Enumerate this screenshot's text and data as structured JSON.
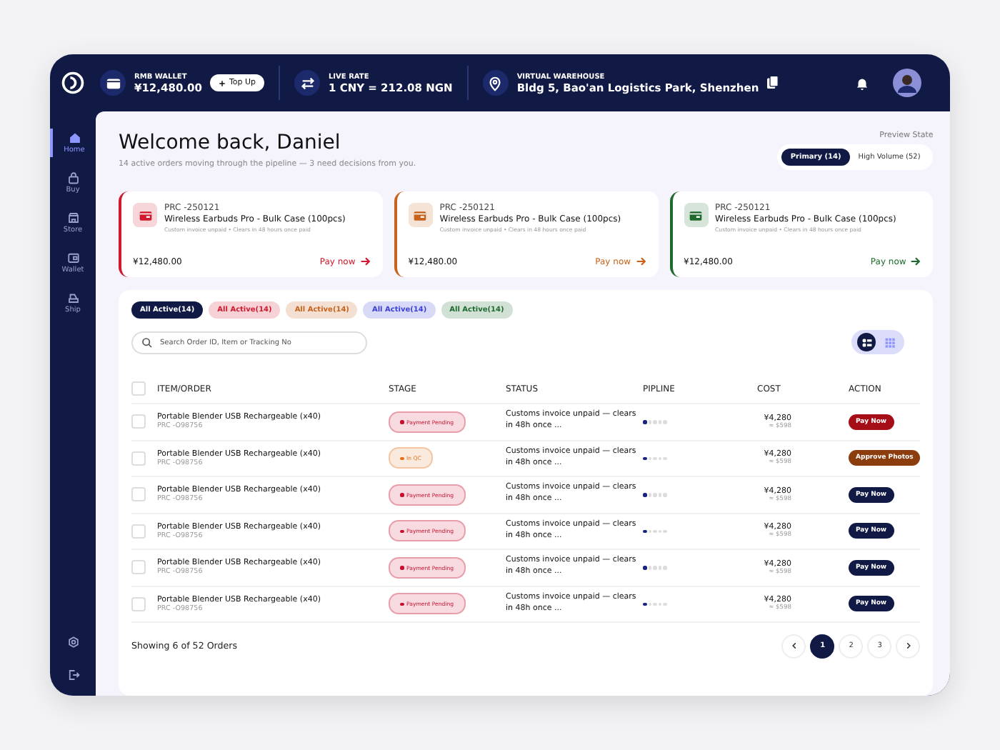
{
  "topbar": {
    "wallet_label": "RMB WALLET",
    "wallet_value": "¥12,480.00",
    "top_up": "Top Up",
    "rate_label": "LIVE RATE",
    "rate_value": "1 CNY = 212.08 NGN",
    "warehouse_label": "VIRTUAL WAREHOUSE",
    "warehouse_value": "Bldg 5, Bao'an Logistics Park, Shenzhen"
  },
  "sidebar": {
    "items": [
      {
        "label": "Home",
        "selected": true
      },
      {
        "label": "Buy",
        "selected": false
      },
      {
        "label": "Store",
        "selected": false
      },
      {
        "label": "Wallet",
        "selected": false
      },
      {
        "label": "Ship",
        "selected": false
      }
    ]
  },
  "header": {
    "title": "Welcome back, Daniel",
    "subtitle": "14 active orders moving through the pipeline — 3 need decisions from you.",
    "preview_label": "Preview State",
    "preview_options": [
      {
        "label": "Primary (14)",
        "selected": true
      },
      {
        "label": "High Volume (52)",
        "selected": false
      }
    ]
  },
  "cards": [
    {
      "code": "PRC -250121",
      "title": "Wireless Earbuds Pro -  Bulk Case (100pcs)",
      "note": "Custom invoice unpaid • Clears in 48 hours once paid",
      "amount": "¥12,480.00",
      "action": "Pay now",
      "color": "#d0192e"
    },
    {
      "code": "PRC -250121",
      "title": "Wireless Earbuds Pro -  Bulk Case (100pcs)",
      "note": "Custom invoice unpaid • Clears in 48 hours once paid",
      "amount": "¥12,480.00",
      "action": "Pay now",
      "color": "#c8621c"
    },
    {
      "code": "PRC -250121",
      "title": "Wireless Earbuds Pro -  Bulk Case (100pcs)",
      "note": "Custom invoice unpaid • Clears in 48 hours once paid",
      "amount": "¥12,480.00",
      "action": "Pay now",
      "color": "#1f6b2e"
    }
  ],
  "filters": [
    {
      "label": "All Active(14)",
      "selected": true,
      "color": "#111a45"
    },
    {
      "label": "All Active(14)",
      "selected": false,
      "color": "#d0192e"
    },
    {
      "label": "All Active(14)",
      "selected": false,
      "color": "#c8621c"
    },
    {
      "label": "All Active(14)",
      "selected": false,
      "color": "#3b3fd6"
    },
    {
      "label": "All Active(14)",
      "selected": false,
      "color": "#1f6b2e"
    }
  ],
  "search": {
    "placeholder": "Search Order ID, Item or Tracking No"
  },
  "view_toggle": [
    {
      "selected": true
    },
    {
      "selected": false
    }
  ],
  "table": {
    "select_all_checked": false,
    "columns": [
      "ITEM/ORDER",
      "STAGE",
      "STATUS",
      "PIPLINE",
      "COST",
      "ACTION"
    ],
    "rows": [
      {
        "checked": false,
        "item": "Portable Blender USB Rechargeable (x40)",
        "order": "PRC -O98756",
        "stage": {
          "label": "Payment Pending",
          "color": "#c8102e"
        },
        "status": "Customs invoice unpaid — clears in 48h once ...",
        "level": 0.2,
        "cost": "¥4,280",
        "cost_usd": "≈ $598",
        "action": {
          "label": "Pay Now",
          "color": "#a50e16"
        }
      },
      {
        "checked": false,
        "item": "Portable Blender USB Rechargeable (x40)",
        "order": "PRC -O98756",
        "stage": {
          "label": "In QC",
          "color": "#e0701e"
        },
        "status": "Customs invoice unpaid — clears in 48h once ...",
        "level": 0.2,
        "cost": "¥4,280",
        "cost_usd": "≈ $598",
        "action": {
          "label": "Approve Photos",
          "color": "#8b3d0d"
        }
      },
      {
        "checked": false,
        "item": "Portable Blender USB Rechargeable (x40)",
        "order": "PRC -O98756",
        "stage": {
          "label": "Payment Pending",
          "color": "#c8102e"
        },
        "status": "Customs invoice unpaid — clears in 48h once ...",
        "level": 0.2,
        "cost": "¥4,280",
        "cost_usd": "≈ $598",
        "action": {
          "label": "Pay Now",
          "color": "#111a45"
        }
      },
      {
        "checked": false,
        "item": "Portable Blender USB Rechargeable (x40)",
        "order": "PRC -O98756",
        "stage": {
          "label": "Payment Pending",
          "color": "#c8102e"
        },
        "status": "Customs invoice unpaid — clears in 48h once ...",
        "level": 0.2,
        "cost": "¥4,280",
        "cost_usd": "≈ $598",
        "action": {
          "label": "Pay Now",
          "color": "#111a45"
        }
      },
      {
        "checked": false,
        "item": "Portable Blender USB Rechargeable (x40)",
        "order": "PRC -O98756",
        "stage": {
          "label": "Payment Pending",
          "color": "#c8102e"
        },
        "status": "Customs invoice unpaid — clears in 48h once ...",
        "level": 0.2,
        "cost": "¥4,280",
        "cost_usd": "≈ $598",
        "action": {
          "label": "Pay Now",
          "color": "#111a45"
        }
      },
      {
        "checked": false,
        "item": "Portable Blender USB Rechargeable (x40)",
        "order": "PRC -O98756",
        "stage": {
          "label": "Payment Pending",
          "color": "#c8102e"
        },
        "status": "Customs invoice unpaid — clears in 48h once ...",
        "level": 0.2,
        "cost": "¥4,280",
        "cost_usd": "≈ $598",
        "action": {
          "label": "Pay Now",
          "color": "#111a45"
        }
      }
    ]
  },
  "footer": {
    "summary": "Showing 6 of 52 Orders",
    "pages": [
      {
        "label": "1",
        "selected": true
      },
      {
        "label": "2",
        "selected": false
      },
      {
        "label": "3",
        "selected": false
      }
    ]
  }
}
